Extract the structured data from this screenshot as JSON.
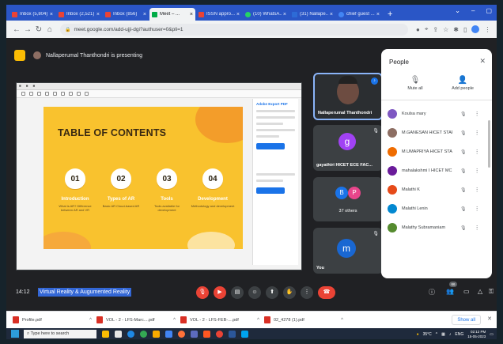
{
  "tabs": [
    {
      "label": "Inbox (5,804)",
      "color": "#ea4335"
    },
    {
      "label": "Inbox (2,521)",
      "color": "#ea4335"
    },
    {
      "label": "Inbox (856)",
      "color": "#ea4335"
    },
    {
      "label": "Meet – ...",
      "color": "#00ac47",
      "active": true
    },
    {
      "label": "ISSN appro...",
      "color": "#ea4335"
    },
    {
      "label": "(10) WhatsA...",
      "color": "#25d366"
    },
    {
      "label": "(31) Nallape...",
      "color": "#2d6bd6"
    },
    {
      "label": "chief guest ...",
      "color": "#4285f4"
    }
  ],
  "address": {
    "url": "meet.google.com/add-ujji-dgi?authuser=0&pli=1"
  },
  "presenter_text": "Nallaperumal Thanthondri is presenting",
  "slide": {
    "title": "TABLE OF CONTENTS",
    "items": [
      {
        "num": "01",
        "label": "Introduction",
        "desc": "What is AR? Difference between AR and VR"
      },
      {
        "num": "02",
        "label": "Types of AR",
        "desc": "Basic AR Cloud-based AR"
      },
      {
        "num": "03",
        "label": "Tools",
        "desc": "Tools available for development"
      },
      {
        "num": "04",
        "label": "Development",
        "desc": "Methodology and development"
      }
    ],
    "side_title": "Adobe Export PDF"
  },
  "tiles": {
    "host": "Nallaperumal Thanthondri",
    "second": {
      "initial": "g",
      "name": "gayathiri HICET ECE FAC..."
    },
    "others": {
      "initials": [
        "B",
        "P"
      ],
      "label": "37 others"
    },
    "you": {
      "initial": "m",
      "label": "You"
    }
  },
  "people_panel": {
    "title": "People",
    "mute_all": "Mute all",
    "add_people": "Add people",
    "participants": [
      {
        "name": "Koulsa mary",
        "color": "#7e57c2"
      },
      {
        "name": "M.GANESAN HICET STAF...",
        "color": "#8d6e63"
      },
      {
        "name": "M.UMAPRIYA HICET STAF...",
        "color": "#ef6c00"
      },
      {
        "name": "mahalakshmi I HICET MC...",
        "color": "#6a1b9a"
      },
      {
        "name": "Malathi K",
        "color": "#e64a19"
      },
      {
        "name": "Malathi Lenin",
        "color": "#0288d1"
      },
      {
        "name": "Malathy Subramaniam",
        "color": "#558b2f"
      }
    ]
  },
  "meeting": {
    "time": "14:12",
    "title": "Virtual Reality & Augumented Reality",
    "people_count": "66"
  },
  "downloads": [
    {
      "name": "Profile.pdf"
    },
    {
      "name": "VOL - 2 - LFS-Marc....pdf"
    },
    {
      "name": "VOL - 2 - LFS-FEB-....pdf"
    },
    {
      "name": "02_4278 (1).pdf"
    }
  ],
  "show_all": "Show all",
  "taskbar": {
    "search_placeholder": "Type here to search",
    "weather": "35°C",
    "lang": "ENG",
    "time": "02:12 PM",
    "date": "15-05-2023"
  }
}
